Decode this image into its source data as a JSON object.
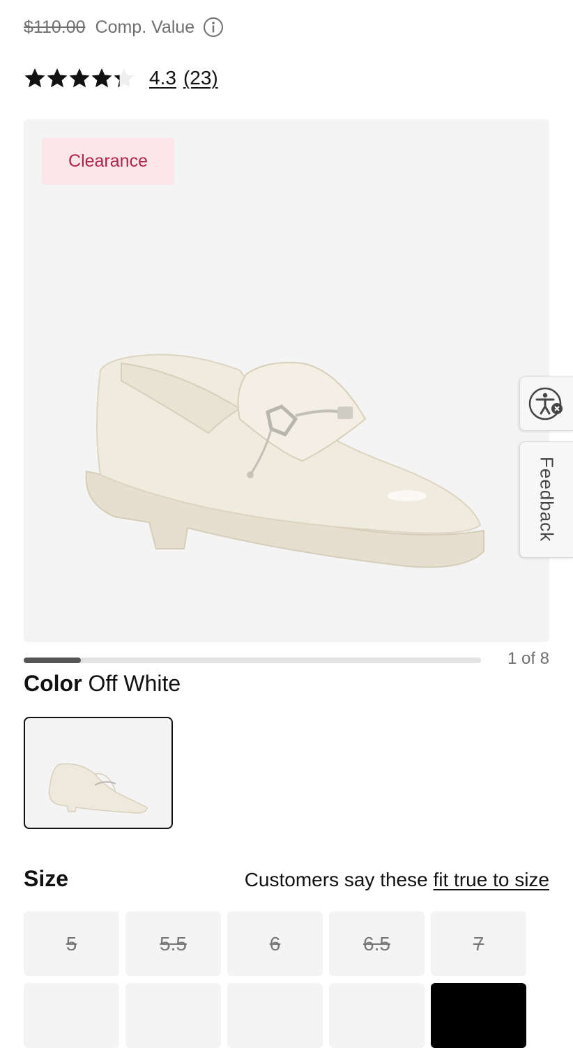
{
  "price": {
    "compare_value": "$110.00",
    "compare_label": "Comp. Value"
  },
  "rating": {
    "score": "4.3",
    "count": "(23)",
    "stars_filled_fraction": 0.86
  },
  "gallery": {
    "badge": "Clearance",
    "counter": "1 of 8",
    "progress_fraction": 0.125
  },
  "side_tabs": {
    "feedback": "Feedback"
  },
  "color": {
    "label": "Color",
    "value": "Off White"
  },
  "size": {
    "heading": "Size",
    "fit_prefix": "Customers say these",
    "fit_link": "fit true to size",
    "options": [
      {
        "label": "5",
        "available": false
      },
      {
        "label": "5.5",
        "available": false
      },
      {
        "label": "6",
        "available": false
      },
      {
        "label": "6.5",
        "available": false
      },
      {
        "label": "7",
        "available": false
      },
      {
        "label": "",
        "available": false
      },
      {
        "label": "",
        "available": false
      },
      {
        "label": "",
        "available": false
      },
      {
        "label": "",
        "available": false
      },
      {
        "label": "",
        "available": true,
        "selected": true
      }
    ]
  },
  "colors": {
    "badge_bg": "#fbe6ea",
    "badge_text": "#b1254a",
    "product": "#ede9dd"
  },
  "icons": {
    "info": "info-icon",
    "star": "star-icon",
    "accessibility": "accessibility-icon"
  }
}
